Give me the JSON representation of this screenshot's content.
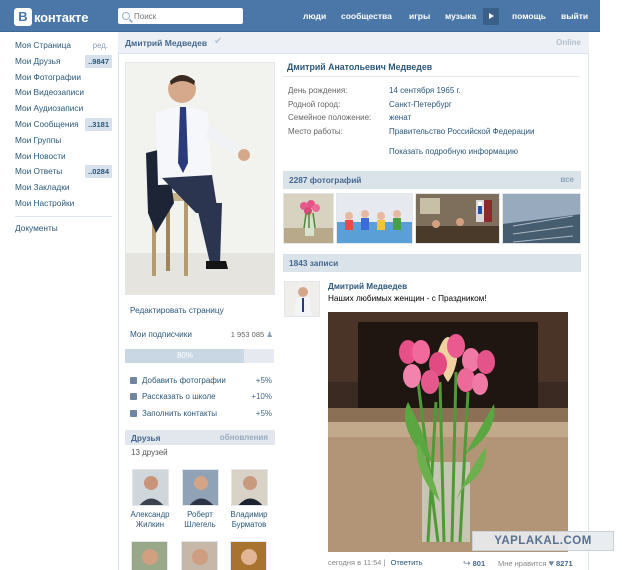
{
  "header": {
    "logo_letter": "В",
    "logo_text": "контакте",
    "search_placeholder": "Поиск",
    "nav": [
      "люди",
      "сообщества",
      "игры",
      "музыка",
      "помощь",
      "выйти"
    ]
  },
  "sidebar": {
    "items": [
      {
        "label": "Моя Страница",
        "badge": "ред."
      },
      {
        "label": "Мои Друзья",
        "badge": "..9847"
      },
      {
        "label": "Мои Фотографии",
        "badge": ""
      },
      {
        "label": "Мои Видеозаписи",
        "badge": ""
      },
      {
        "label": "Мои Аудиозаписи",
        "badge": ""
      },
      {
        "label": "Мои Сообщения",
        "badge": "..3181"
      },
      {
        "label": "Мои Группы",
        "badge": ""
      },
      {
        "label": "Мои Новости",
        "badge": ""
      },
      {
        "label": "Мои Ответы",
        "badge": "..0284"
      },
      {
        "label": "Мои Закладки",
        "badge": ""
      },
      {
        "label": "Мои Настройки",
        "badge": ""
      }
    ],
    "documents": "Документы"
  },
  "page": {
    "title": "Дмитрий Медведев",
    "status": "Online"
  },
  "profile_left": {
    "edit_page": "Редактировать страницу",
    "subscribers_label": "Мои подписчики",
    "subscribers_count": "1 953 085",
    "progress_label": "80%",
    "progress_value": 0.8,
    "tasks": [
      {
        "label": "Добавить фотографии",
        "pct": "+5%"
      },
      {
        "label": "Рассказать о школе",
        "pct": "+10%"
      },
      {
        "label": "Заполнить контакты",
        "pct": "+5%"
      }
    ],
    "friends_title": "Друзья",
    "friends_updates": "обновления",
    "friends_count": "13 друзей",
    "friends": [
      {
        "first": "Александр",
        "last": "Жилкин"
      },
      {
        "first": "Роберт",
        "last": "Шлегель"
      },
      {
        "first": "Владимир",
        "last": "Бурматов"
      }
    ]
  },
  "profile_info": {
    "full_name": "Дмитрий Анатольевич Медведев",
    "rows": [
      {
        "label": "День рождения:",
        "value": "14 сентября 1965 г."
      },
      {
        "label": "Родной город:",
        "value": "Санкт-Петербург"
      },
      {
        "label": "Семейное положение:",
        "value": "женат"
      },
      {
        "label": "Место работы:",
        "value": "Правительство Российской Федерации"
      }
    ],
    "show_more": "Показать подробную информацию"
  },
  "photos": {
    "title": "2287 фотографий",
    "all_label": "все"
  },
  "wall": {
    "title": "1843 записи",
    "post": {
      "author": "Дмитрий Медведев",
      "text": "Наших любимых женщин - с Праздником!",
      "date": "сегодня в 11:54",
      "reply": "Ответить",
      "shares": "801",
      "likes_label": "Мне нравится",
      "likes": "8271"
    }
  },
  "watermark": "YAPLAKAL.COM"
}
